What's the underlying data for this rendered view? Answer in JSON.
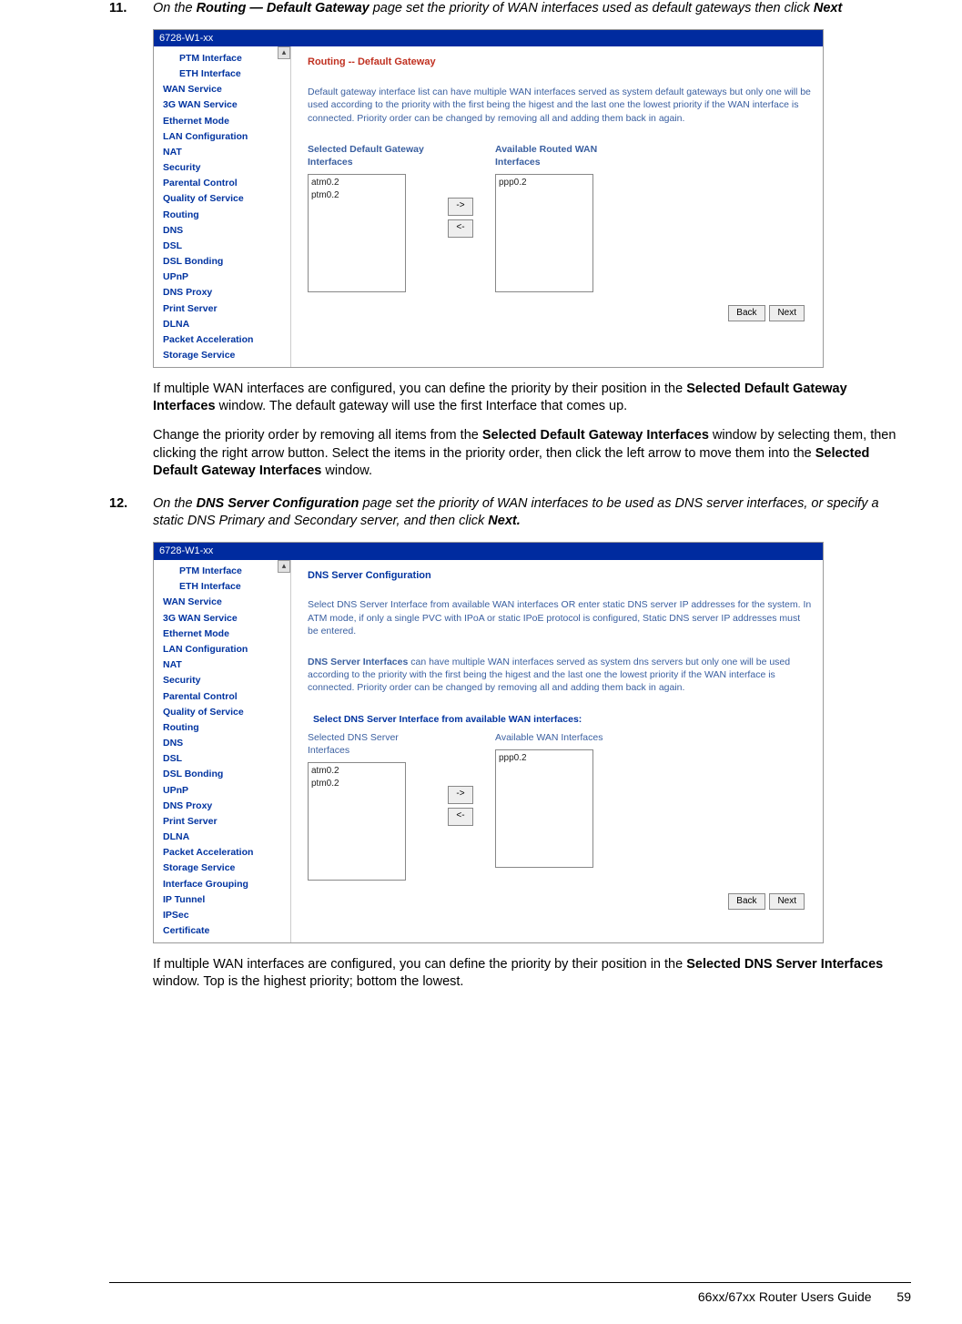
{
  "step11": {
    "num": "11.",
    "lead_a": "On the ",
    "lead_b": "Routing — Default Gateway",
    "lead_c": " page set the priority of WAN interfaces used as default gateways then click ",
    "lead_d": "Next"
  },
  "shot1": {
    "title": "6728-W1-xx",
    "nav": [
      "PTM Interface",
      "ETH Interface",
      "WAN Service",
      "3G WAN Service",
      "Ethernet Mode",
      "LAN Configuration",
      "NAT",
      "Security",
      "Parental Control",
      "Quality of Service",
      "Routing",
      "DNS",
      "DSL",
      "DSL Bonding",
      "UPnP",
      "DNS Proxy",
      "Print Server",
      "DLNA",
      "Packet Acceleration",
      "Storage Service"
    ],
    "heading": "Routing -- Default Gateway",
    "desc": "Default gateway interface list can have multiple WAN interfaces served as system default gateways but only one will be used according to the priority with the first being the higest and the last one the lowest priority if the WAN interface is connected. Priority order can be changed by removing all and adding them back in again.",
    "left_label": "Selected Default Gateway Interfaces",
    "right_label": "Available Routed WAN Interfaces",
    "left_items": [
      "atm0.2",
      "ptm0.2"
    ],
    "right_items": [
      "ppp0.2"
    ],
    "arrow_r": "->",
    "arrow_l": "<-",
    "btn_back": "Back",
    "btn_next": "Next"
  },
  "para_a1": "If multiple WAN interfaces are configured, you can define the priority by their position in the ",
  "para_a1_b": "Selected Default Gateway Interfaces",
  "para_a1_c": " window. The default gateway will use the first Interface that comes up.",
  "para_a2_a": "Change the priority order by removing all items from the ",
  "para_a2_b": "Selected Default Gateway Interfaces",
  "para_a2_c": " window by selecting them, then clicking the right arrow button. Select the items in the priority order, then click the left arrow to move them into the ",
  "para_a2_d": "Selected Default Gateway Interfaces",
  "para_a2_e": " window.",
  "step12": {
    "num": "12.",
    "lead_a": "On the ",
    "lead_b": "DNS Server Configuration",
    "lead_c": " page set the priority of WAN interfaces to be used as DNS server interfaces, or specify a static DNS Primary and Secondary server, and then click ",
    "lead_d": "Next."
  },
  "shot2": {
    "title": "6728-W1-xx",
    "nav": [
      "PTM Interface",
      "ETH Interface",
      "WAN Service",
      "3G WAN Service",
      "Ethernet Mode",
      "LAN Configuration",
      "NAT",
      "Security",
      "Parental Control",
      "Quality of Service",
      "Routing",
      "DNS",
      "DSL",
      "DSL Bonding",
      "UPnP",
      "DNS Proxy",
      "Print Server",
      "DLNA",
      "Packet Acceleration",
      "Storage Service",
      "Interface Grouping",
      "IP Tunnel",
      "IPSec",
      "Certificate"
    ],
    "heading": "DNS Server Configuration",
    "desc1": "Select DNS Server Interface from available WAN interfaces OR enter static DNS server IP addresses for the system. In ATM mode, if only a single PVC with IPoA or static IPoE protocol is configured, Static DNS server IP addresses must be entered.",
    "desc2_a": "DNS Server Interfaces",
    "desc2_b": " can have multiple WAN interfaces served as system dns servers but only one will be used according to the priority with the first being the higest and the last one the lowest priority if the WAN interface is connected. Priority order can be changed by removing all and adding them back in again.",
    "radio_label": "Select DNS Server Interface from available WAN interfaces:",
    "left_label": "Selected DNS Server Interfaces",
    "right_label": "Available WAN Interfaces",
    "left_items": [
      "atm0.2",
      "ptm0.2"
    ],
    "right_items": [
      "ppp0.2"
    ],
    "arrow_r": "->",
    "arrow_l": "<-",
    "btn_back": "Back",
    "btn_next": "Next"
  },
  "para_b1_a": "If multiple WAN interfaces are configured, you can define the priority by their position in the ",
  "para_b1_b": "Selected DNS Server Interfaces",
  "para_b1_c": " window. Top is the highest priority; bottom the lowest.",
  "footer": {
    "title": "66xx/67xx Router Users Guide",
    "page": "59"
  }
}
